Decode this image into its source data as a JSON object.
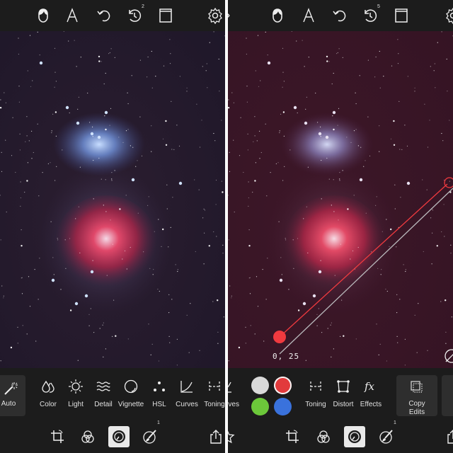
{
  "colors": {
    "app_bg": "#1c1c1c",
    "panel_button_bg": "#2e2e2e",
    "active_tool_bg": "#e9e9e9",
    "icon_color": "#e6e6e6",
    "sky_left": "#231a2c",
    "sky_right": "#3a1526",
    "marker_red": "#f03a3f",
    "line_gray": "#b9b9bc"
  },
  "left": {
    "topbar": {
      "icons": [
        "mask-icon",
        "text-icon",
        "undo-icon",
        "history-icon",
        "compare-icon",
        "settings-icon"
      ],
      "history_count": "2"
    },
    "tools": {
      "auto_label": "Auto",
      "items": [
        {
          "icon": "color-drops-icon",
          "label": "Color"
        },
        {
          "icon": "light-sun-icon",
          "label": "Light"
        },
        {
          "icon": "detail-waves-icon",
          "label": "Detail"
        },
        {
          "icon": "vignette-icon",
          "label": "Vignette"
        },
        {
          "icon": "hsl-dots-icon",
          "label": "HSL"
        },
        {
          "icon": "curves-icon",
          "label": "Curves"
        },
        {
          "icon": "toning-icon",
          "label": "Toning"
        }
      ]
    },
    "bottombar": {
      "icons": [
        "crop-icon",
        "filters-icon",
        "adjust-dial-icon",
        "brush-icon",
        "share-icon"
      ],
      "active": "adjust-dial-icon",
      "brush_badge": "1"
    }
  },
  "right": {
    "topbar": {
      "icons": [
        "mask-icon",
        "text-icon",
        "undo-icon",
        "history-icon",
        "compare-icon",
        "settings-icon"
      ],
      "history_count": "5"
    },
    "tools": {
      "partial_label": "rves",
      "swatches": [
        "#d9d9d9",
        "#e23a3c",
        "#6cc83a",
        "#3a72dc"
      ],
      "selected_swatch": "#e23a3c",
      "items": [
        {
          "icon": "toning-icon",
          "label": "Toning"
        },
        {
          "icon": "distort-icon",
          "label": "Distort"
        },
        {
          "icon": "effects-fx-icon",
          "label": "Effects"
        }
      ],
      "copy_edits_label_1": "Copy",
      "copy_edits_label_2": "Edits"
    },
    "gradient_overlay": {
      "coordinate_readout": "0, 25"
    },
    "bottombar": {
      "icons": [
        "favorite-star-icon",
        "crop-icon",
        "filters-icon",
        "adjust-dial-icon",
        "brush-icon",
        "share-icon"
      ],
      "active": "adjust-dial-icon",
      "brush_badge": "1"
    }
  }
}
